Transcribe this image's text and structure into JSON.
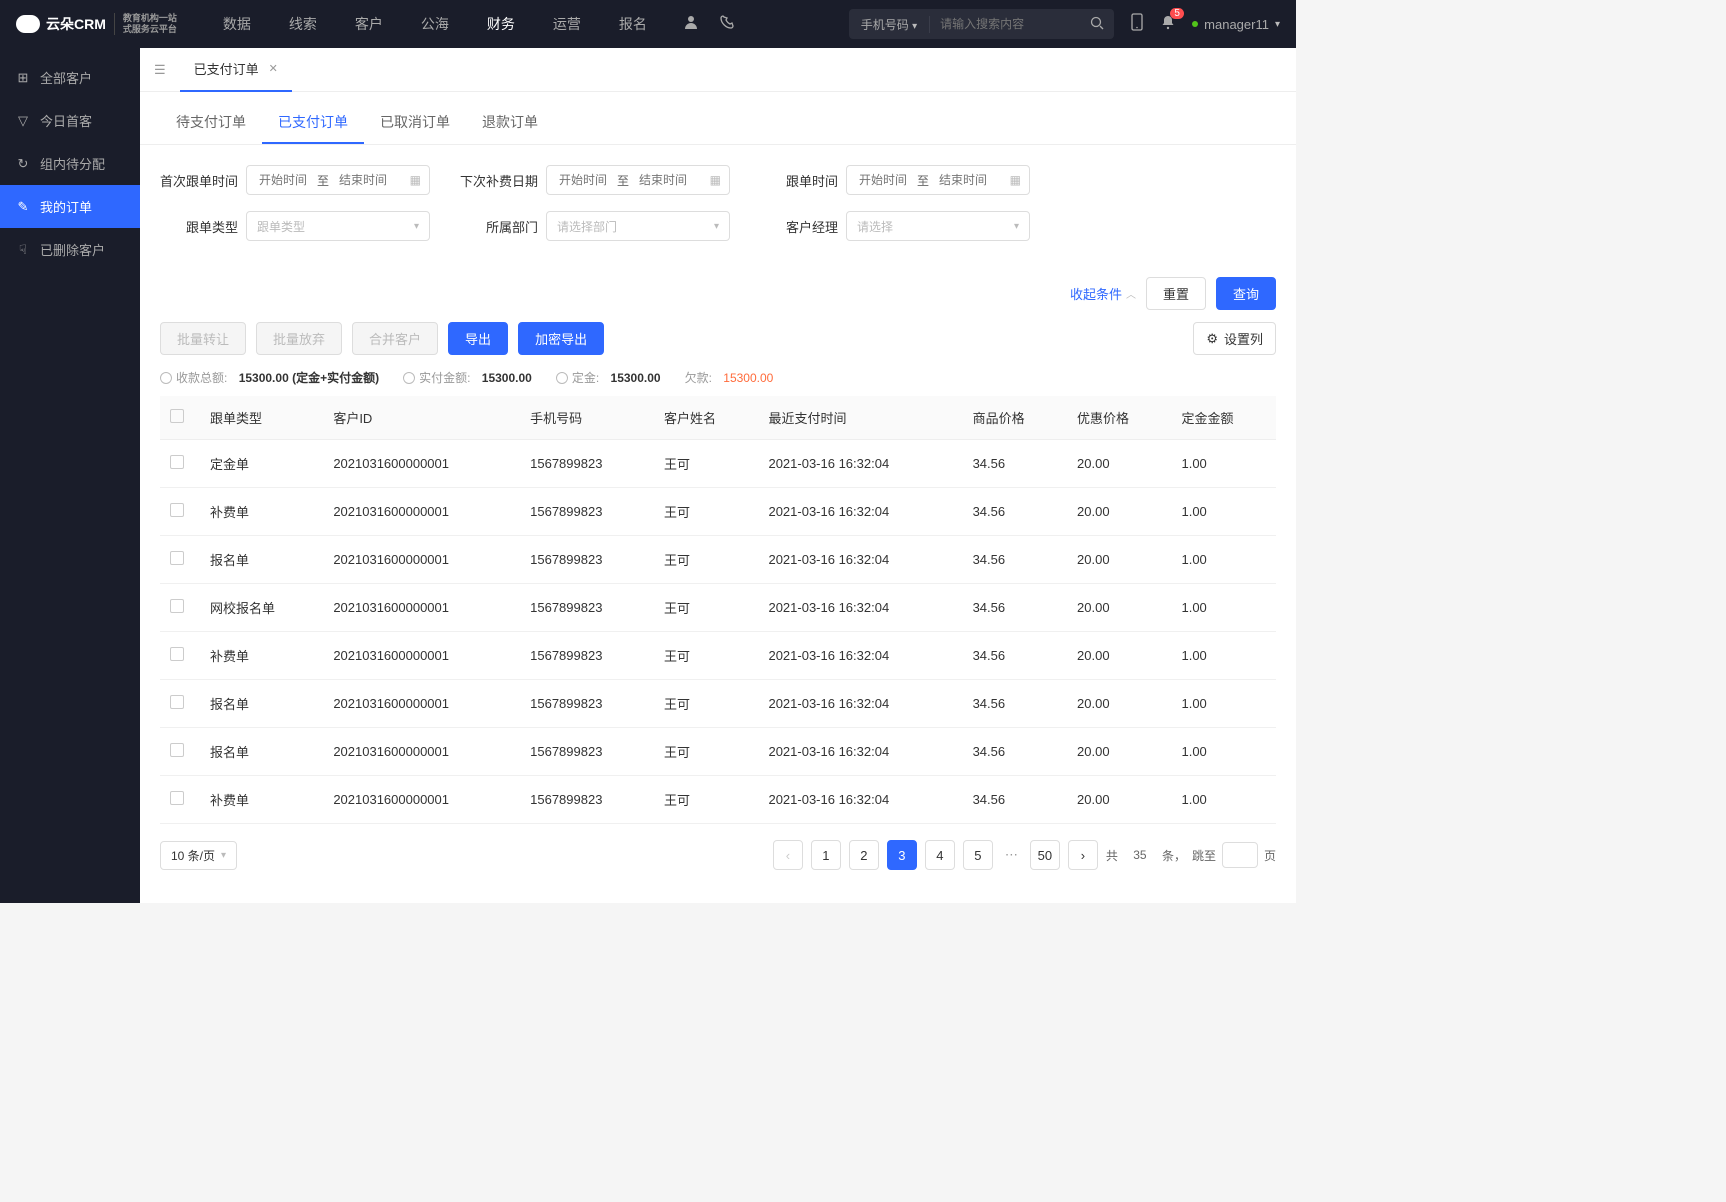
{
  "logo": {
    "brand": "云朵CRM",
    "sub1": "教育机构一站",
    "sub2": "式服务云平台"
  },
  "nav": [
    "数据",
    "线索",
    "客户",
    "公海",
    "财务",
    "运营",
    "报名"
  ],
  "nav_active": 4,
  "search": {
    "type": "手机号码",
    "placeholder": "请输入搜索内容"
  },
  "notif_count": "5",
  "username": "manager11",
  "sidebar": [
    {
      "icon": "⊞",
      "label": "全部客户"
    },
    {
      "icon": "▽",
      "label": "今日首客"
    },
    {
      "icon": "↻",
      "label": "组内待分配"
    },
    {
      "icon": "✎",
      "label": "我的订单"
    },
    {
      "icon": "☟",
      "label": "已删除客户"
    }
  ],
  "sidebar_active": 3,
  "page_tab": "已支付订单",
  "subtabs": [
    "待支付订单",
    "已支付订单",
    "已取消订单",
    "退款订单"
  ],
  "subtab_active": 1,
  "filters": {
    "row1": [
      {
        "label": "首次跟单时间",
        "type": "daterange",
        "start": "开始时间",
        "sep": "至",
        "end": "结束时间"
      },
      {
        "label": "下次补费日期",
        "type": "daterange",
        "start": "开始时间",
        "sep": "至",
        "end": "结束时间"
      },
      {
        "label": "跟单时间",
        "type": "daterange",
        "start": "开始时间",
        "sep": "至",
        "end": "结束时间"
      }
    ],
    "row2": [
      {
        "label": "跟单类型",
        "type": "select",
        "placeholder": "跟单类型"
      },
      {
        "label": "所属部门",
        "type": "select",
        "placeholder": "请选择部门"
      },
      {
        "label": "客户经理",
        "type": "select",
        "placeholder": "请选择"
      }
    ],
    "collapse": "收起条件",
    "reset": "重置",
    "query": "查询"
  },
  "actions": {
    "batch_transfer": "批量转让",
    "batch_abandon": "批量放弃",
    "merge": "合并客户",
    "export": "导出",
    "encrypt_export": "加密导出",
    "settings": "设置列"
  },
  "summary": {
    "total_label": "收款总额:",
    "total_value": "15300.00 (定金+实付金额)",
    "paid_label": "实付金额:",
    "paid_value": "15300.00",
    "deposit_label": "定金:",
    "deposit_value": "15300.00",
    "owe_label": "欠款:",
    "owe_value": "15300.00"
  },
  "columns": [
    "跟单类型",
    "客户ID",
    "手机号码",
    "客户姓名",
    "最近支付时间",
    "商品价格",
    "优惠价格",
    "定金金额"
  ],
  "rows": [
    {
      "type": "定金单",
      "cid": "2021031600000001",
      "phone": "1567899823",
      "name": "王可",
      "time": "2021-03-16 16:32:04",
      "price": "34.56",
      "discount": "20.00",
      "deposit": "1.00"
    },
    {
      "type": "补费单",
      "cid": "2021031600000001",
      "phone": "1567899823",
      "name": "王可",
      "time": "2021-03-16 16:32:04",
      "price": "34.56",
      "discount": "20.00",
      "deposit": "1.00"
    },
    {
      "type": "报名单",
      "cid": "2021031600000001",
      "phone": "1567899823",
      "name": "王可",
      "time": "2021-03-16 16:32:04",
      "price": "34.56",
      "discount": "20.00",
      "deposit": "1.00"
    },
    {
      "type": "网校报名单",
      "cid": "2021031600000001",
      "phone": "1567899823",
      "name": "王可",
      "time": "2021-03-16 16:32:04",
      "price": "34.56",
      "discount": "20.00",
      "deposit": "1.00"
    },
    {
      "type": "补费单",
      "cid": "2021031600000001",
      "phone": "1567899823",
      "name": "王可",
      "time": "2021-03-16 16:32:04",
      "price": "34.56",
      "discount": "20.00",
      "deposit": "1.00"
    },
    {
      "type": "报名单",
      "cid": "2021031600000001",
      "phone": "1567899823",
      "name": "王可",
      "time": "2021-03-16 16:32:04",
      "price": "34.56",
      "discount": "20.00",
      "deposit": "1.00"
    },
    {
      "type": "报名单",
      "cid": "2021031600000001",
      "phone": "1567899823",
      "name": "王可",
      "time": "2021-03-16 16:32:04",
      "price": "34.56",
      "discount": "20.00",
      "deposit": "1.00"
    },
    {
      "type": "补费单",
      "cid": "2021031600000001",
      "phone": "1567899823",
      "name": "王可",
      "time": "2021-03-16 16:32:04",
      "price": "34.56",
      "discount": "20.00",
      "deposit": "1.00"
    }
  ],
  "pagination": {
    "size": "10 条/页",
    "pages": [
      "1",
      "2",
      "3",
      "4",
      "5"
    ],
    "active": 2,
    "last": "50",
    "total_prefix": "共",
    "total": "35",
    "total_suffix": "条，",
    "jump": "跳至",
    "page_suffix": "页",
    "prev": "‹",
    "next": "›"
  }
}
